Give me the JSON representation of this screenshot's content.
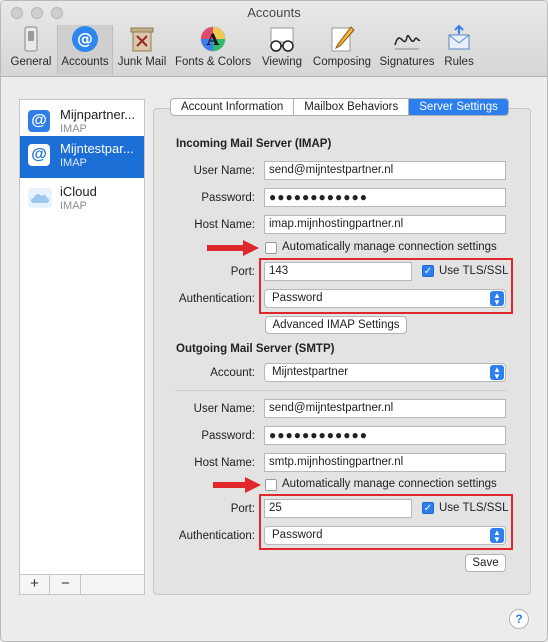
{
  "window": {
    "title": "Accounts"
  },
  "toolbar": {
    "items": [
      {
        "label": "General",
        "icon": "switch-icon"
      },
      {
        "label": "Accounts",
        "icon": "at-sign-icon"
      },
      {
        "label": "Junk Mail",
        "icon": "trash-bin-icon"
      },
      {
        "label": "Fonts & Colors",
        "icon": "font-color-icon"
      },
      {
        "label": "Viewing",
        "icon": "glasses-icon"
      },
      {
        "label": "Composing",
        "icon": "pencil-icon"
      },
      {
        "label": "Signatures",
        "icon": "signature-icon"
      },
      {
        "label": "Rules",
        "icon": "rules-envelope-icon"
      }
    ],
    "active": "Accounts"
  },
  "sidebar": {
    "accounts": [
      {
        "name": "Mijnpartner...",
        "type": "IMAP",
        "icon": "at-sign-icon",
        "selected": false
      },
      {
        "name": "Mijntestpar...",
        "type": "IMAP",
        "icon": "at-sign-icon",
        "selected": true
      },
      {
        "name": "iCloud",
        "type": "IMAP",
        "icon": "cloud-icon",
        "selected": false
      }
    ],
    "add_label": "+",
    "remove_label": "−"
  },
  "tabs": {
    "items": [
      "Account Information",
      "Mailbox Behaviors",
      "Server Settings"
    ],
    "active": "Server Settings"
  },
  "incoming": {
    "heading": "Incoming Mail Server (IMAP)",
    "user_label": "User Name:",
    "user_value": "send@mijntestpartner.nl",
    "password_label": "Password:",
    "password_value": "●●●●●●●●●●●●",
    "host_label": "Host Name:",
    "host_value": "imap.mijnhostingpartner.nl",
    "auto_manage_label": "Automatically manage connection settings",
    "auto_manage_checked": false,
    "port_label": "Port:",
    "port_value": "143",
    "tls_label": "Use TLS/SSL",
    "tls_checked": true,
    "auth_label": "Authentication:",
    "auth_value": "Password",
    "advanced_button": "Advanced IMAP Settings"
  },
  "outgoing": {
    "heading": "Outgoing Mail Server (SMTP)",
    "account_label": "Account:",
    "account_value": "Mijntestpartner",
    "user_label": "User Name:",
    "user_value": "send@mijntestpartner.nl",
    "password_label": "Password:",
    "password_value": "●●●●●●●●●●●●",
    "host_label": "Host Name:",
    "host_value": "smtp.mijnhostingpartner.nl",
    "auto_manage_label": "Automatically manage connection settings",
    "auto_manage_checked": false,
    "port_label": "Port:",
    "port_value": "25",
    "tls_label": "Use TLS/SSL",
    "tls_checked": true,
    "auth_label": "Authentication:",
    "auth_value": "Password",
    "save_button": "Save"
  },
  "help": {
    "label": "?"
  },
  "colors": {
    "accent": "#2d7ff0",
    "highlight": "#e0282c",
    "selection": "#1b6fd6"
  }
}
